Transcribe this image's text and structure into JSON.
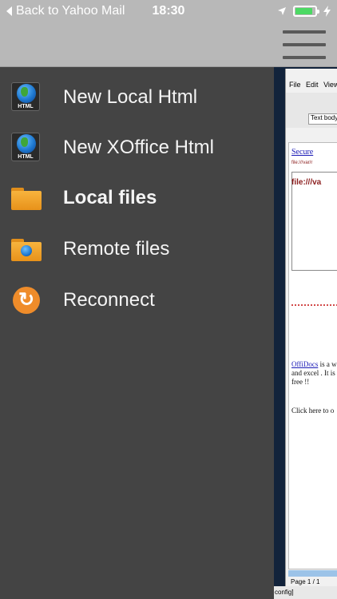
{
  "status_bar": {
    "back_label": "Back to Yahoo Mail",
    "time": "18:30",
    "battery_color": "#4cd964"
  },
  "header": {
    "menu_icon": "hamburger-icon"
  },
  "menu": {
    "items": [
      {
        "label": "New Local Html",
        "icon": "html-globe-icon"
      },
      {
        "label": "New XOffice Html",
        "icon": "html-globe-icon"
      },
      {
        "label": "Local files",
        "icon": "folder-icon",
        "active": true
      },
      {
        "label": "Remote files",
        "icon": "remote-folder-icon"
      },
      {
        "label": "Reconnect",
        "icon": "reconnect-icon"
      }
    ]
  },
  "desktop": {
    "menubar": [
      "File",
      "Edit",
      "View"
    ],
    "combo_text": "Text body",
    "link_text": "Secure",
    "file_label": "file:///va",
    "file_label_small": "file:///var/r",
    "para_link": "OffiDocs",
    "para_line1_rest": " is a w",
    "para_line2": "and excel . It is",
    "para_line3": "free !!",
    "click_text": "Click here to o",
    "page_text": "Page 1 / 1",
    "taskbar_text": "config]"
  },
  "colors": {
    "drawer_bg": "#444444",
    "header_bg": "#b8b8b8",
    "folder_orange": "#f0a22f",
    "reconnect_orange": "#ef8c2a"
  }
}
